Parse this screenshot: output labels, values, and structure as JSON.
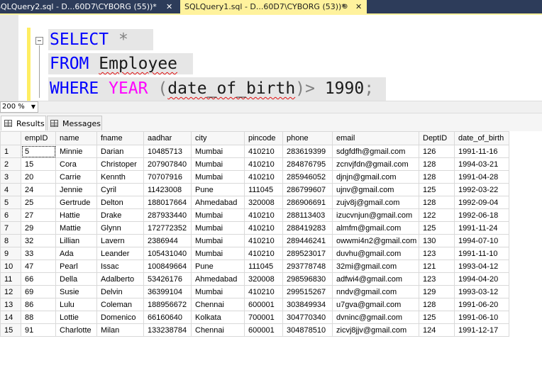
{
  "tabs": [
    {
      "label": "SQLQuery2.sql - D...60D7\\CYBORG (55))*",
      "close": "✕"
    },
    {
      "label": "SQLQuery1.sql - D...60D7\\CYBORG (53))*",
      "pin": "⊕",
      "close": "✕"
    }
  ],
  "editor": {
    "line1": {
      "kw": "SELECT",
      "star": "*"
    },
    "line2": {
      "kw": "FROM",
      "table": "Employee"
    },
    "line3": {
      "kw": "WHERE",
      "fn": "YEAR",
      "open": "(",
      "col": "date_of_birth",
      "close": ")",
      "op": ">",
      "value": "1990",
      "semi": ";"
    }
  },
  "zoom": {
    "value": "200 %",
    "arrow": "▼"
  },
  "result_tabs": {
    "results": "Results",
    "messages": "Messages"
  },
  "grid": {
    "columns": [
      "empID",
      "name",
      "fname",
      "aadhar",
      "city",
      "pincode",
      "phone",
      "email",
      "DeptID",
      "date_of_birth"
    ],
    "rows": [
      [
        "1",
        "5",
        "Minnie",
        "Darian",
        "10485713",
        "Mumbai",
        "410210",
        "283619399",
        "sdgfdfh@gmail.com",
        "126",
        "1991-11-16"
      ],
      [
        "2",
        "15",
        "Cora",
        "Christoper",
        "207907840",
        "Mumbai",
        "410210",
        "284876795",
        "zcnvjfdn@gmail.com",
        "128",
        "1994-03-21"
      ],
      [
        "3",
        "20",
        "Carrie",
        "Kennth",
        "70707916",
        "Mumbai",
        "410210",
        "285946052",
        "djnjn@gmail.com",
        "128",
        "1991-04-28"
      ],
      [
        "4",
        "24",
        "Jennie",
        "Cyril",
        "11423008",
        "Pune",
        "111045",
        "286799607",
        "ujnv@gmail.com",
        "125",
        "1992-03-22"
      ],
      [
        "5",
        "25",
        "Gertrude",
        "Delton",
        "188017664",
        "Ahmedabad",
        "320008",
        "286906691",
        "zujv8j@gmail.com",
        "128",
        "1992-09-04"
      ],
      [
        "6",
        "27",
        "Hattie",
        "Drake",
        "287933440",
        "Mumbai",
        "410210",
        "288113403",
        "izucvnjun@gmail.com",
        "122",
        "1992-06-18"
      ],
      [
        "7",
        "29",
        "Mattie",
        "Glynn",
        "172772352",
        "Mumbai",
        "410210",
        "288419283",
        "almfm@gmail.com",
        "125",
        "1991-11-24"
      ],
      [
        "8",
        "32",
        "Lillian",
        "Lavern",
        "2386944",
        "Mumbai",
        "410210",
        "289446241",
        "owwmi4n2@gmail.com",
        "130",
        "1994-07-10"
      ],
      [
        "9",
        "33",
        "Ada",
        "Leander",
        "105431040",
        "Mumbai",
        "410210",
        "289523017",
        "duvhu@gmail.com",
        "123",
        "1991-11-10"
      ],
      [
        "10",
        "47",
        "Pearl",
        "Issac",
        "100849664",
        "Pune",
        "111045",
        "293778748",
        "32mi@gmail.com",
        "121",
        "1993-04-12"
      ],
      [
        "11",
        "66",
        "Della",
        "Adalberto",
        "53426176",
        "Ahmedabad",
        "320008",
        "298596830",
        "adfwi4@gmail.com",
        "123",
        "1994-04-20"
      ],
      [
        "12",
        "69",
        "Susie",
        "Delvin",
        "36399104",
        "Mumbai",
        "410210",
        "299515267",
        "nndv@gmail.com",
        "129",
        "1993-03-12"
      ],
      [
        "13",
        "86",
        "Lulu",
        "Coleman",
        "188956672",
        "Chennai",
        "600001",
        "303849934",
        "u7gva@gmail.com",
        "128",
        "1991-06-20"
      ],
      [
        "14",
        "88",
        "Lottie",
        "Domenico",
        "66160640",
        "Kolkata",
        "700001",
        "304770340",
        "dvninc@gmail.com",
        "125",
        "1991-06-10"
      ],
      [
        "15",
        "91",
        "Charlotte",
        "Milan",
        "133238784",
        "Chennai",
        "600001",
        "304878510",
        "zicvj8jjv@gmail.com",
        "124",
        "1991-12-17"
      ]
    ]
  }
}
